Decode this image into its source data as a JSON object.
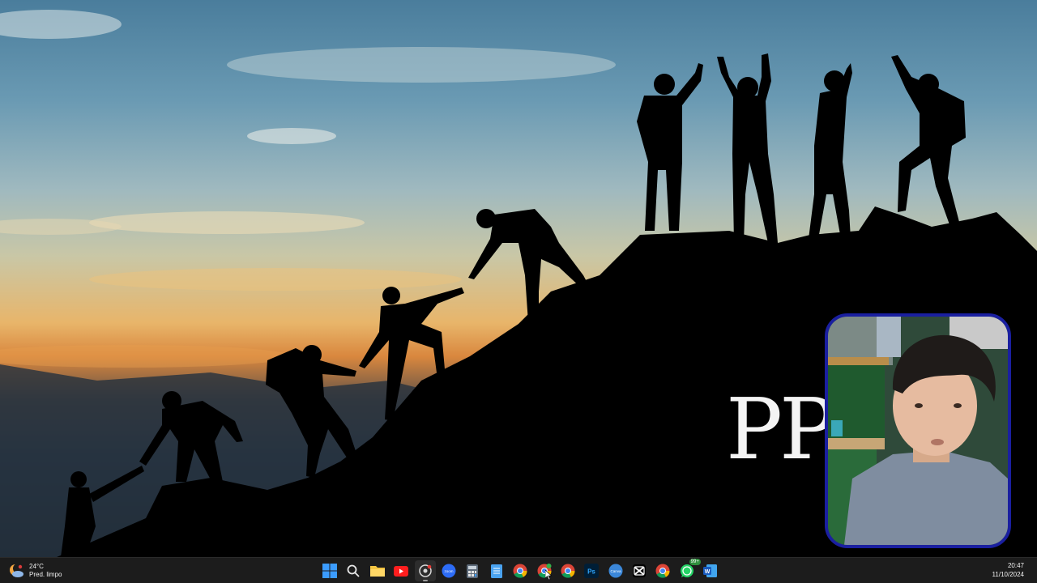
{
  "wallpaper": {
    "overlay_text": "PP"
  },
  "taskbar": {
    "weather": {
      "temperature": "24°C",
      "description": "Pred. limpo"
    },
    "apps": [
      {
        "name": "start-button-icon",
        "label": "Start"
      },
      {
        "name": "search-icon",
        "label": "Search"
      },
      {
        "name": "file-explorer-icon",
        "label": "File Explorer"
      },
      {
        "name": "youtube-icon",
        "label": "YouTube"
      },
      {
        "name": "chrome-profile-icon",
        "label": "Chrome"
      },
      {
        "name": "zoom-icon",
        "label": "Zoom"
      },
      {
        "name": "calculator-icon",
        "label": "Calculator"
      },
      {
        "name": "notepad-icon",
        "label": "Notepad"
      },
      {
        "name": "chrome-icon",
        "label": "Chrome"
      },
      {
        "name": "chrome-alt-icon",
        "label": "Chrome"
      },
      {
        "name": "chrome-2-icon",
        "label": "Chrome"
      },
      {
        "name": "photoshop-icon",
        "label": "Ps"
      },
      {
        "name": "canva-icon",
        "label": "Canva"
      },
      {
        "name": "capcut-icon",
        "label": "CapCut"
      },
      {
        "name": "chrome-3-icon",
        "label": "Chrome"
      },
      {
        "name": "whatsapp-icon",
        "label": "WhatsApp",
        "badge": "99+"
      },
      {
        "name": "word-icon",
        "label": "W"
      }
    ],
    "clock": {
      "time": "20:47",
      "date": "11/10/2024"
    }
  },
  "colors": {
    "taskbar_bg": "#1c1c1c",
    "webcam_border": "#1a1fa0",
    "windows_blue": "#3b9cff"
  }
}
